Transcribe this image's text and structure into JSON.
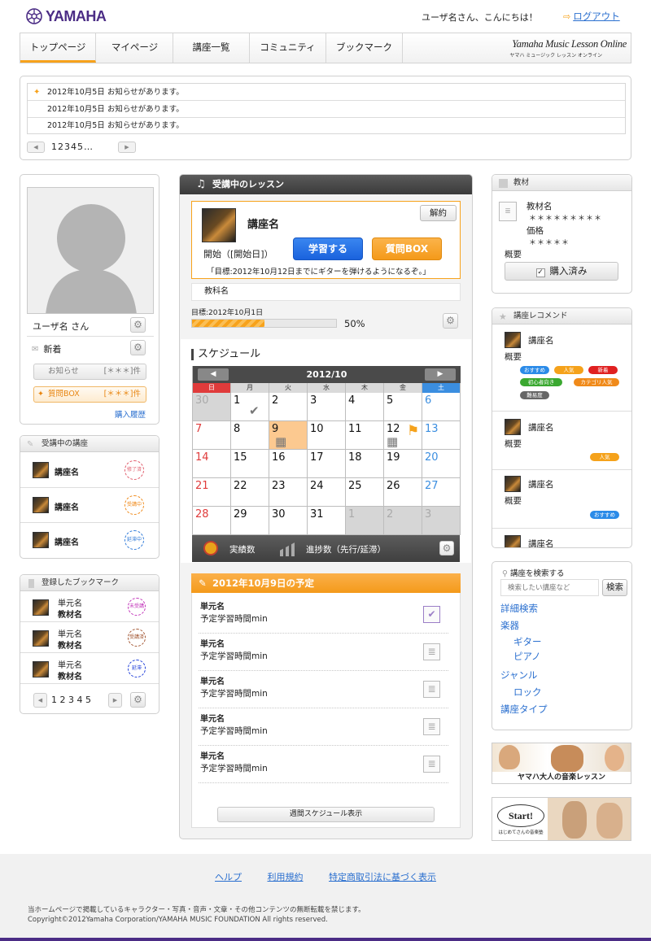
{
  "header": {
    "logo": "YAMAHA",
    "greeting": "ユーザ名さん、こんにちは！",
    "logout": "ログアウト",
    "brand_title": "Yamaha Music Lesson Online",
    "brand_sub": "ヤマハ ミュージック レッスン オンライン"
  },
  "nav": [
    "トップページ",
    "マイページ",
    "講座一覧",
    "コミュニティ",
    "ブックマーク"
  ],
  "news": {
    "items": [
      "2012年10月5日 お知らせがあります。",
      "2012年10月5日 お知らせがあります。",
      "2012年10月5日 お知らせがあります。"
    ],
    "pages": "12345…"
  },
  "profile": {
    "name": "ユーザ名 さん",
    "new_label": "新着",
    "notice": "お知らせ",
    "notice_count": "[＊＊＊]件",
    "question": "質問BOX",
    "question_count": "[＊＊＊]件",
    "history": "購入履歴"
  },
  "my_courses": {
    "title": "受講中の講座",
    "items": [
      {
        "name": "講座名",
        "stamp": "修了済"
      },
      {
        "name": "講座名",
        "stamp": "受講中"
      },
      {
        "name": "講座名",
        "stamp": "延滞中"
      }
    ]
  },
  "bookmarks": {
    "title": "登録したブックマーク",
    "items": [
      {
        "unit": "単元名",
        "material": "教材名",
        "stamp": "未受講"
      },
      {
        "unit": "単元名",
        "material": "教材名",
        "stamp": "受講済"
      },
      {
        "unit": "単元名",
        "material": "教材名",
        "stamp": "延滞"
      }
    ],
    "pages": "1 2 3 4 5"
  },
  "lesson": {
    "title": "受講中のレッスン",
    "course": "講座名",
    "cancel": "解約",
    "start": "開始（[開始日]）",
    "study_btn": "学習する",
    "question_btn": "質問BOX",
    "goal": "「目標:2012年10月12日までにギターを弾けるようになるぞ。」",
    "textbook": "教科名",
    "target": "目標:2012年10月1日",
    "progress_text": "50%",
    "progress": 0.5
  },
  "schedule": {
    "title": "スケジュール",
    "month": "2012/10",
    "weekdays": [
      "日",
      "月",
      "火",
      "水",
      "木",
      "金",
      "土"
    ],
    "weeks": [
      [
        "30",
        "1",
        "2",
        "3",
        "4",
        "5",
        "6"
      ],
      [
        "7",
        "8",
        "9",
        "10",
        "11",
        "12",
        "13"
      ],
      [
        "14",
        "15",
        "16",
        "17",
        "18",
        "19",
        "20"
      ],
      [
        "21",
        "22",
        "23",
        "24",
        "25",
        "26",
        "27"
      ],
      [
        "28",
        "29",
        "30",
        "31",
        "1",
        "2",
        "3"
      ]
    ],
    "achievements": "実績数",
    "progress_label": "進捗数（先行/延滞）"
  },
  "today": {
    "title": "2012年10月9日の予定",
    "items": [
      {
        "unit": "単元名",
        "time": "予定学習時間min"
      },
      {
        "unit": "単元名",
        "time": "予定学習時間min"
      },
      {
        "unit": "単元名",
        "time": "予定学習時間min"
      },
      {
        "unit": "単元名",
        "time": "予定学習時間min"
      },
      {
        "unit": "単元名",
        "time": "予定学習時間min"
      }
    ],
    "weekly_btn": "週間スケジュール表示"
  },
  "material": {
    "title": "教材",
    "name_label": "教材名",
    "name_value": "＊＊＊＊＊＊＊＊＊",
    "price_label": "価格",
    "price_value": "＊＊＊＊＊",
    "summary": "概要",
    "purchased": "購入済み"
  },
  "recommend": {
    "title": "講座レコメンド",
    "items": [
      {
        "name": "講座名",
        "summary": "概要"
      },
      {
        "name": "講座名",
        "summary": "概要"
      },
      {
        "name": "講座名",
        "summary": "概要"
      },
      {
        "name": "講座名"
      }
    ],
    "tags1": [
      "おすすめ",
      "人気",
      "新着",
      "初心者向き",
      "カテゴリ人気",
      "難易度"
    ],
    "tag2": "人気",
    "tag3": "おすすめ"
  },
  "search": {
    "title": "講座を検索する",
    "placeholder": "検索したい講座など",
    "button": "検索",
    "links": [
      "詳細検索",
      "楽器",
      "ギター",
      "ピアノ",
      "ジャンル",
      "ロック",
      "講座タイプ"
    ]
  },
  "banners": {
    "b1": "ヤマハ大人の音楽レッスン",
    "b2": "Start!",
    "b2sub": "はじめてさんの音楽塾"
  },
  "footer": {
    "links": [
      "ヘルプ",
      "利用規約",
      "特定商取引法に基づく表示"
    ],
    "notice": "当ホームページで掲載しているキャラクター・写真・音声・文章・その他コンテンツの無断転載を禁じます。",
    "copyright": "Copyright©2012Yamaha Corporation/YAMAHA MUSIC FOUNDATION All rights reserved."
  },
  "colors": {
    "accent": "#f7a21b",
    "blue": "#1f6fe5",
    "brand": "#4b2c85"
  }
}
